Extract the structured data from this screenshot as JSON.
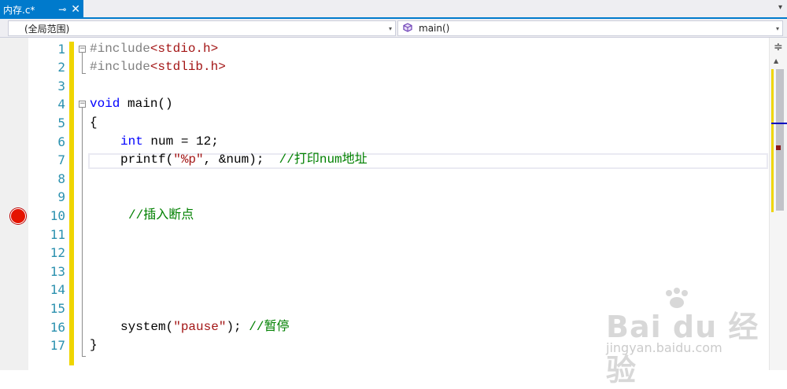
{
  "tab": {
    "title": "内存.c*",
    "pin_glyph": "⊸",
    "close_glyph": "✕"
  },
  "tabbar": {
    "overflow_glyph": "▾"
  },
  "navigation": {
    "scope": "(全局范围)",
    "member": "main()",
    "dropdown_glyph": "▾"
  },
  "line_numbers": [
    "1",
    "2",
    "3",
    "4",
    "5",
    "6",
    "7",
    "8",
    "9",
    "10",
    "11",
    "12",
    "13",
    "14",
    "15",
    "16",
    "17"
  ],
  "code": {
    "l1_pp": "#include",
    "l1_hdr": "<stdio.h>",
    "l2_pp": "#include",
    "l2_hdr": "<stdlib.h>",
    "l4_kw": "void",
    "l4_rest": " main()",
    "l5": "{",
    "l6_kw": "int",
    "l6_rest": " num = 12;",
    "l7_a": "printf(",
    "l7_str": "\"%p\"",
    "l7_b": ", &num);  ",
    "l7_cmt": "//打印num地址",
    "l10_cmt": "//插入断点",
    "l16_a": "system(",
    "l16_str": "\"pause\"",
    "l16_b": "); ",
    "l16_cmt": "//暂停",
    "l17": "}"
  },
  "scrollbar": {
    "split_glyph": "≑",
    "up_glyph": "▲"
  },
  "watermark": {
    "brand": "Bai du 经验",
    "url": "jingyan.baidu.com"
  },
  "colors": {
    "accent": "#007acc",
    "keyword": "#0000ff",
    "string": "#a31515",
    "comment": "#008000",
    "line_number": "#2b91af",
    "change_bar": "#efd500",
    "breakpoint": "#e51400"
  },
  "icons": {
    "method": "method-icon",
    "breakpoint": "breakpoint-icon"
  }
}
